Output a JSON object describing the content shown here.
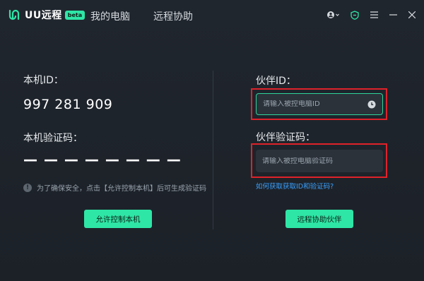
{
  "app": {
    "logo_text": "UU远程",
    "badge": "beta",
    "tabs": [
      {
        "label": "我的电脑"
      },
      {
        "label": "远程协助"
      }
    ],
    "titlebar_icons": [
      "user-icon",
      "shield-icon",
      "menu-icon",
      "minimize-icon",
      "close-icon"
    ]
  },
  "local": {
    "id_label": "本机ID：",
    "id_value": "997 281 909",
    "code_label": "本机验证码：",
    "code_value": "— — — — — — — —",
    "notice": "为了确保安全，点击【允许控制本机】后可生成验证码",
    "allow_button": "允许控制本机"
  },
  "partner": {
    "id_label": "伙伴ID：",
    "id_placeholder": "请输入被控电脑ID",
    "code_label": "伙伴验证码：",
    "code_placeholder": "请输入被控电脑验证码",
    "help_link": "如何获取获取ID和验证码?",
    "assist_button": "远程协助伙伴"
  },
  "colors": {
    "accent": "#2ee6a6",
    "background": "#1f252c",
    "field": "#2b323a",
    "highlight": "#e0222a",
    "link": "#3aa1ff"
  }
}
